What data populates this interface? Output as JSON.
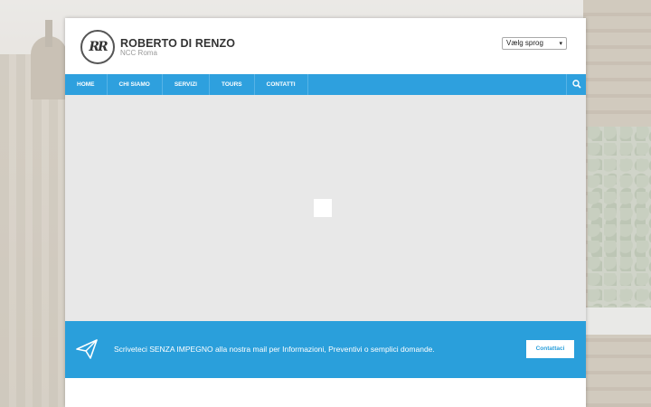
{
  "brand": {
    "logo_text": "RR",
    "title": "ROBERTO DI RENZO",
    "subtitle": "NCC Roma"
  },
  "language_select": {
    "selected": "Vælg sprog"
  },
  "nav": {
    "items": [
      {
        "label": "HOME"
      },
      {
        "label": "CHI SIAMO"
      },
      {
        "label": "SERVIZI"
      },
      {
        "label": "TOURS"
      },
      {
        "label": "CONTATTI"
      }
    ],
    "search_icon": "search-icon"
  },
  "cta": {
    "icon": "paper-plane-icon",
    "text": "Scriveteci SENZA IMPEGNO alla nostra mail per  Informazioni, Preventivi o semplici domande.",
    "button_label": "Contattaci"
  },
  "colors": {
    "accent": "#2ea0de",
    "hero_bg": "#e8e8e8",
    "cta_bg": "#2a9fdb"
  }
}
